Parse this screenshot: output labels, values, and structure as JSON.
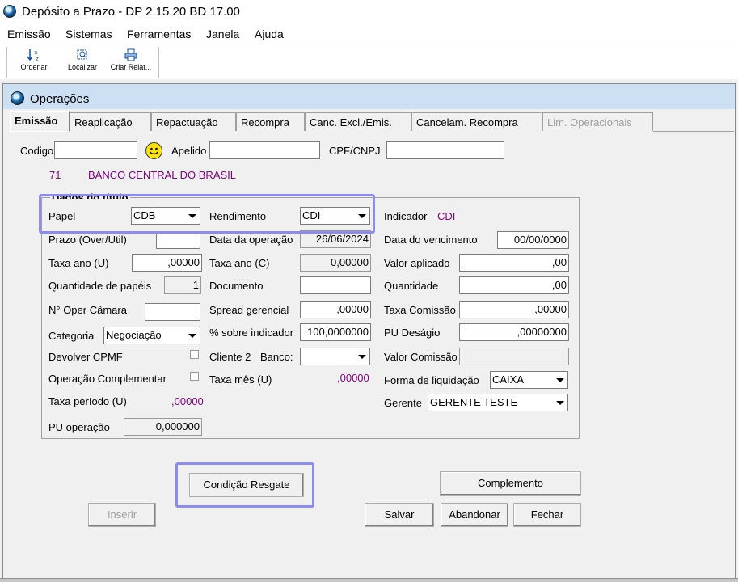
{
  "window": {
    "title": "Depósito a Prazo -  DP 2.15.20 BD 17.00"
  },
  "menu": [
    "Emissão",
    "Sistemas",
    "Ferramentas",
    "Janela",
    "Ajuda"
  ],
  "toolbar": {
    "order": "Ordenar",
    "find": "Localizar",
    "report": "Criar Relat..."
  },
  "child": {
    "title": "Operações"
  },
  "tabs": [
    "Emissão",
    "Reaplicação",
    "Repactuação",
    "Recompra",
    "Canc. Excl./Emis.",
    "Cancelam. Recompra",
    "Lim. Operacionais"
  ],
  "header": {
    "codigo_label": "Codigo",
    "codigo_value": "",
    "apelido_label": "Apelido",
    "apelido_value": "",
    "cpf_label": "CPF/CNPJ",
    "cpf_value": "",
    "bank_code": "71",
    "bank_name": "BANCO CENTRAL DO BRASIL"
  },
  "group": {
    "title": "Dados do título"
  },
  "left": {
    "papel_label": "Papel",
    "papel_value": "CDB",
    "prazo_label": "Prazo (Over/Util)",
    "prazo_value": "",
    "taxa_ano_u_label": "Taxa ano (U)",
    "taxa_ano_u_value": ",00000",
    "qtd_papeis_label": "Quantidade de papéis",
    "qtd_papeis_value": "1",
    "oper_camara_label": "N° Oper Câmara",
    "oper_camara_value": "",
    "categoria_label": "Categoria",
    "categoria_value": "Negociação",
    "devolver_cpmf_label": "Devolver CPMF",
    "oper_compl_label": "Operação Complementar",
    "taxa_periodo_label": "Taxa período (U)",
    "taxa_periodo_value": ",00000",
    "pu_operacao_label": "PU operação",
    "pu_operacao_value": "0,000000"
  },
  "middle": {
    "rendimento_label": "Rendimento",
    "rendimento_value": "CDI",
    "data_operacao_label": "Data da operação",
    "data_operacao_value": "26/06/2024",
    "taxa_ano_c_label": "Taxa ano (C)",
    "taxa_ano_c_value": "0,00000",
    "documento_label": "Documento",
    "documento_value": "",
    "spread_label": "Spread gerencial",
    "spread_value": ",00000",
    "pct_indicador_label": "% sobre indicador",
    "pct_indicador_value": "100,0000000",
    "cliente2_label": "Cliente 2",
    "banco_label": "Banco:",
    "banco_value": "",
    "taxa_mes_label": "Taxa mês (U)",
    "taxa_mes_value": ",00000"
  },
  "right": {
    "indicador_label": "Indicador",
    "indicador_value": "CDI",
    "vencimento_label": "Data do vencimento",
    "vencimento_value": "00/00/0000",
    "valor_aplicado_label": "Valor aplicado",
    "valor_aplicado_value": ",00",
    "quantidade_label": "Quantidade",
    "quantidade_value": ",00",
    "taxa_comissao_label": "Taxa Comissão",
    "taxa_comissao_value": ",00000",
    "pu_desagio_label": "PU Deságio",
    "pu_desagio_value": ",00000000",
    "valor_comissao_label": "Valor Comissão",
    "valor_comissao_value": "",
    "forma_liq_label": "Forma de liquidação",
    "forma_liq_value": "CAIXA",
    "gerente_label": "Gerente",
    "gerente_value": "GERENTE TESTE"
  },
  "buttons": {
    "condicao_resgate": "Condição Resgate",
    "complemento": "Complemento",
    "inserir": "Inserir",
    "salvar": "Salvar",
    "abandonar": "Abandonar",
    "fechar": "Fechar"
  },
  "colors": {
    "highlight": "#8c8cf0",
    "purple_text": "#800080",
    "title_bar": "#cde0f3"
  }
}
